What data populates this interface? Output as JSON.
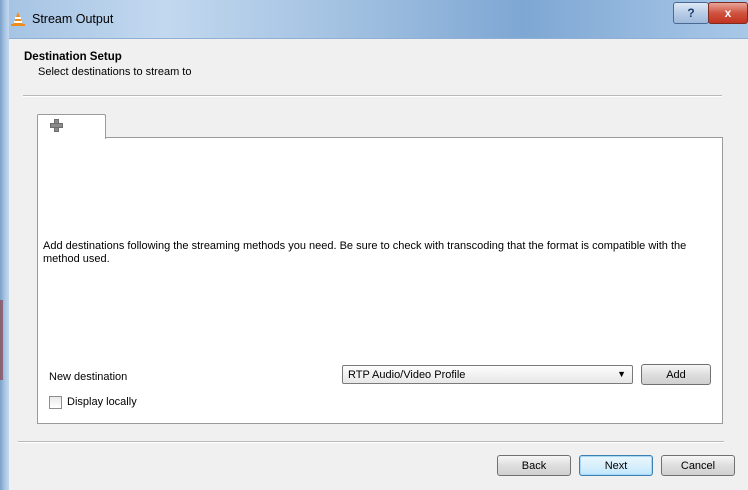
{
  "window": {
    "title": "Stream Output",
    "help_label": "?",
    "close_label": "x"
  },
  "header": {
    "title": "Destination Setup",
    "subtitle": "Select destinations to stream to"
  },
  "tab": {
    "icon": "plus-icon"
  },
  "pane": {
    "description": "Add destinations following the streaming methods you need. Be sure to check with transcoding that the format is compatible with the method used.",
    "new_destination_label": "New destination",
    "destination_select_value": "RTP Audio/Video Profile",
    "add_label": "Add",
    "display_locally_label": "Display locally",
    "display_locally_checked": false
  },
  "footer": {
    "back_label": "Back",
    "next_label": "Next",
    "cancel_label": "Cancel"
  },
  "colors": {
    "titlebar": "#a4c3e3",
    "close_button": "#c1331f",
    "focused_button_border": "#3c7fb1"
  }
}
